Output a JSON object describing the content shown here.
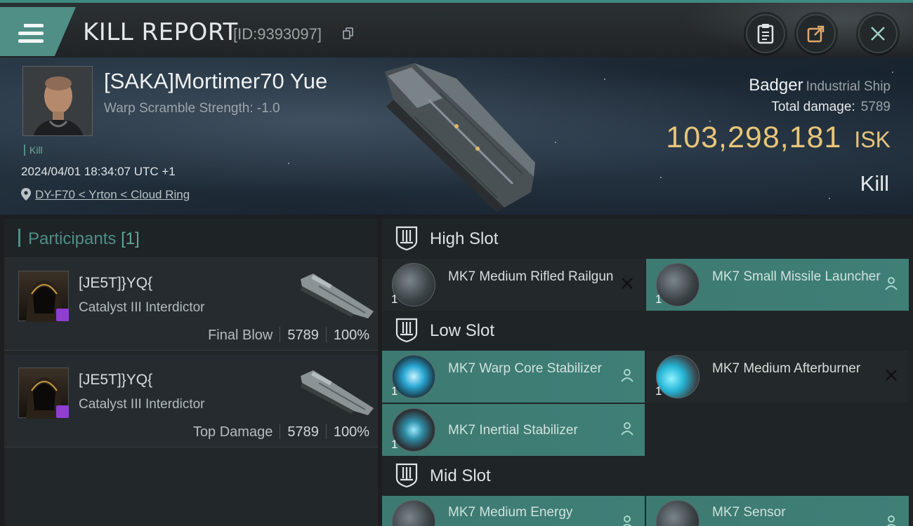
{
  "header": {
    "title": "KILL REPORT",
    "report_id": "[ID:9393097]",
    "icons": [
      "menu-icon",
      "copy-icon",
      "clipboard-icon",
      "share-icon",
      "close-icon"
    ]
  },
  "victim": {
    "name": "[SAKA]Mortimer70 Yue",
    "warp_scramble": "Warp Scramble Strength: -1.0",
    "tag": "Kill",
    "timestamp": "2024/04/01 18:34:07 UTC +1",
    "location": "DY-F70 < Yrton < Cloud Ring",
    "ship_name": "Badger",
    "ship_class": "Industrial Ship",
    "total_damage_label": "Total damage:",
    "total_damage": "5789",
    "isk_value": "103,298,181",
    "isk_unit": "ISK",
    "result": "Kill"
  },
  "participants": {
    "title": "Participants",
    "count": "[1]",
    "rows": [
      {
        "name": "[JE5T]}YQ{",
        "ship": "Catalyst III Interdictor",
        "role": "Final Blow",
        "damage": "5789",
        "percent": "100%"
      },
      {
        "name": "[JE5T]}YQ{",
        "ship": "Catalyst III Interdictor",
        "role": "Top Damage",
        "damage": "5789",
        "percent": "100%"
      }
    ]
  },
  "slots": {
    "high": {
      "label": "High Slot",
      "modules": [
        {
          "name": "MK7 Medium Rifled Railgun",
          "qty": "1",
          "status": "destroyed",
          "icon": "railgun-icon"
        },
        {
          "name": "MK7 Small Missile Launcher",
          "qty": "1",
          "status": "dropped",
          "icon": "missile-launcher-icon"
        }
      ]
    },
    "low": {
      "label": "Low Slot",
      "modules": [
        {
          "name": "MK7 Warp Core Stabilizer",
          "qty": "1",
          "status": "dropped",
          "icon": "warp-core-stabilizer-icon"
        },
        {
          "name": "MK7 Medium Afterburner",
          "qty": "1",
          "status": "destroyed",
          "icon": "afterburner-icon"
        },
        {
          "name": "MK7 Inertial Stabilizer",
          "qty": "1",
          "status": "dropped",
          "icon": "inertial-stabilizer-icon"
        }
      ]
    },
    "mid": {
      "label": "Mid Slot",
      "modules": [
        {
          "name": "MK7 Medium Energy",
          "qty": "",
          "status": "dropped",
          "icon": "energy-module-icon"
        },
        {
          "name": "MK7 Sensor",
          "qty": "",
          "status": "dropped",
          "icon": "sensor-module-icon"
        }
      ]
    }
  },
  "colors": {
    "accent_teal": "#4f8f86",
    "dropped_bg": "#3d7a72",
    "isk_gold": "#e8c57a",
    "kill_tag": "#6fa89e",
    "corp_badge": "#8e3fd2"
  }
}
